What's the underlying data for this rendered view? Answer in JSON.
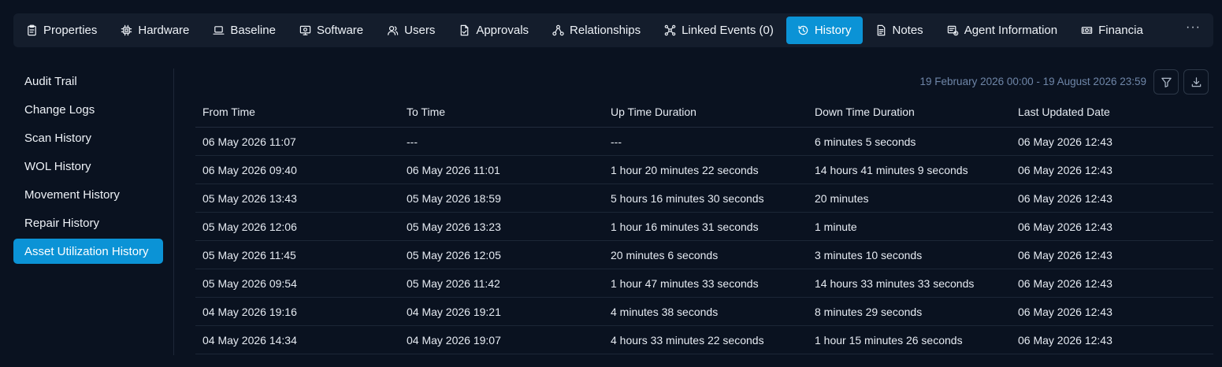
{
  "tabs": [
    {
      "label": "Properties",
      "icon": "clipboard-icon",
      "name": "tab-properties"
    },
    {
      "label": "Hardware",
      "icon": "cpu-chip-icon",
      "name": "tab-hardware"
    },
    {
      "label": "Baseline",
      "icon": "laptop-icon",
      "name": "tab-baseline"
    },
    {
      "label": "Software",
      "icon": "monitor-gear-icon",
      "name": "tab-software"
    },
    {
      "label": "Users",
      "icon": "users-icon",
      "name": "tab-users"
    },
    {
      "label": "Approvals",
      "icon": "document-check-icon",
      "name": "tab-approvals"
    },
    {
      "label": "Relationships",
      "icon": "relationship-nodes-icon",
      "name": "tab-relationships"
    },
    {
      "label": "Linked Events (0)",
      "icon": "linked-nodes-icon",
      "name": "tab-linked-events"
    },
    {
      "label": "History",
      "icon": "history-icon",
      "name": "tab-history",
      "active": true
    },
    {
      "label": "Notes",
      "icon": "note-icon",
      "name": "tab-notes"
    },
    {
      "label": "Agent Information",
      "icon": "agent-info-icon",
      "name": "tab-agent-information"
    },
    {
      "label": "Financia",
      "icon": "money-icon",
      "name": "tab-financial"
    }
  ],
  "more_label": "···",
  "sidebar": {
    "items": [
      {
        "label": "Audit Trail",
        "name": "sidebar-item-audit-trail"
      },
      {
        "label": "Change Logs",
        "name": "sidebar-item-change-logs"
      },
      {
        "label": "Scan History",
        "name": "sidebar-item-scan-history"
      },
      {
        "label": "WOL History",
        "name": "sidebar-item-wol-history"
      },
      {
        "label": "Movement History",
        "name": "sidebar-item-movement-history"
      },
      {
        "label": "Repair History",
        "name": "sidebar-item-repair-history"
      },
      {
        "label": "Asset Utilization History",
        "name": "sidebar-item-asset-utilization-history",
        "active": true
      }
    ]
  },
  "date_range": "19 February 2026 00:00 - 19 August 2026 23:59",
  "table": {
    "headers": [
      "From Time",
      "To Time",
      "Up Time Duration",
      "Down Time Duration",
      "Last Updated Date"
    ],
    "rows": [
      [
        "06 May 2026 11:07",
        "---",
        "---",
        "6 minutes 5 seconds",
        "06 May 2026 12:43"
      ],
      [
        "06 May 2026 09:40",
        "06 May 2026 11:01",
        "1 hour 20 minutes 22 seconds",
        "14 hours 41 minutes 9 seconds",
        "06 May 2026 12:43"
      ],
      [
        "05 May 2026 13:43",
        "05 May 2026 18:59",
        "5 hours 16 minutes 30 seconds",
        "20 minutes",
        "06 May 2026 12:43"
      ],
      [
        "05 May 2026 12:06",
        "05 May 2026 13:23",
        "1 hour 16 minutes 31 seconds",
        "1 minute",
        "06 May 2026 12:43"
      ],
      [
        "05 May 2026 11:45",
        "05 May 2026 12:05",
        "20 minutes 6 seconds",
        "3 minutes 10 seconds",
        "06 May 2026 12:43"
      ],
      [
        "05 May 2026 09:54",
        "05 May 2026 11:42",
        "1 hour 47 minutes 33 seconds",
        "14 hours 33 minutes 33 seconds",
        "06 May 2026 12:43"
      ],
      [
        "04 May 2026 19:16",
        "04 May 2026 19:21",
        "4 minutes 38 seconds",
        "8 minutes 29 seconds",
        "06 May 2026 12:43"
      ],
      [
        "04 May 2026 14:34",
        "04 May 2026 19:07",
        "4 hours 33 minutes 22 seconds",
        "1 hour 15 minutes 26 seconds",
        "06 May 2026 12:43"
      ]
    ]
  },
  "colors": {
    "background": "#0a1220",
    "tabbar": "#141d2c",
    "accent": "#0b93d6",
    "muted_text": "#6f86a8"
  }
}
